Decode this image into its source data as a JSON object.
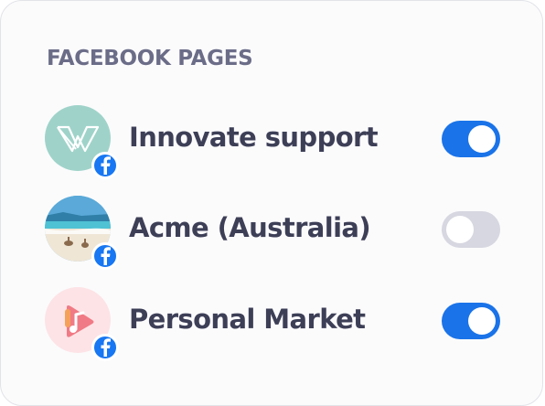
{
  "section": {
    "title": "FACEBOOK PAGES"
  },
  "pages": [
    {
      "name": "Innovate support",
      "enabled": true,
      "avatar_icon": "innovate-logo-icon",
      "network_icon": "facebook-icon"
    },
    {
      "name": "Acme (Australia)",
      "enabled": false,
      "avatar_icon": "beach-photo-icon",
      "network_icon": "facebook-icon"
    },
    {
      "name": "Personal Market",
      "enabled": true,
      "avatar_icon": "music-app-logo-icon",
      "network_icon": "facebook-icon"
    }
  ],
  "colors": {
    "toggle_on": "#1a73e8",
    "toggle_off": "#d6d7e0",
    "facebook": "#1877f2",
    "title": "#6b6d88",
    "text": "#3d3f57"
  }
}
